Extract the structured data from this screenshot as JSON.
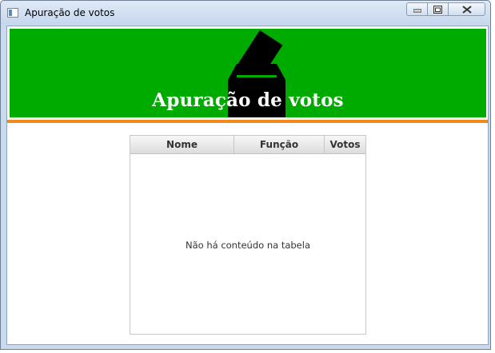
{
  "window": {
    "title": "Apuração de votos"
  },
  "banner": {
    "title": "Apuração de votos",
    "icon": "ballot-box-icon",
    "background_color": "#00ab00",
    "accent_bar_color": "#f08a1c"
  },
  "table": {
    "columns": [
      "Nome",
      "Função",
      "Votos"
    ],
    "rows": [],
    "empty_message": "Não há conteúdo na tabela"
  }
}
